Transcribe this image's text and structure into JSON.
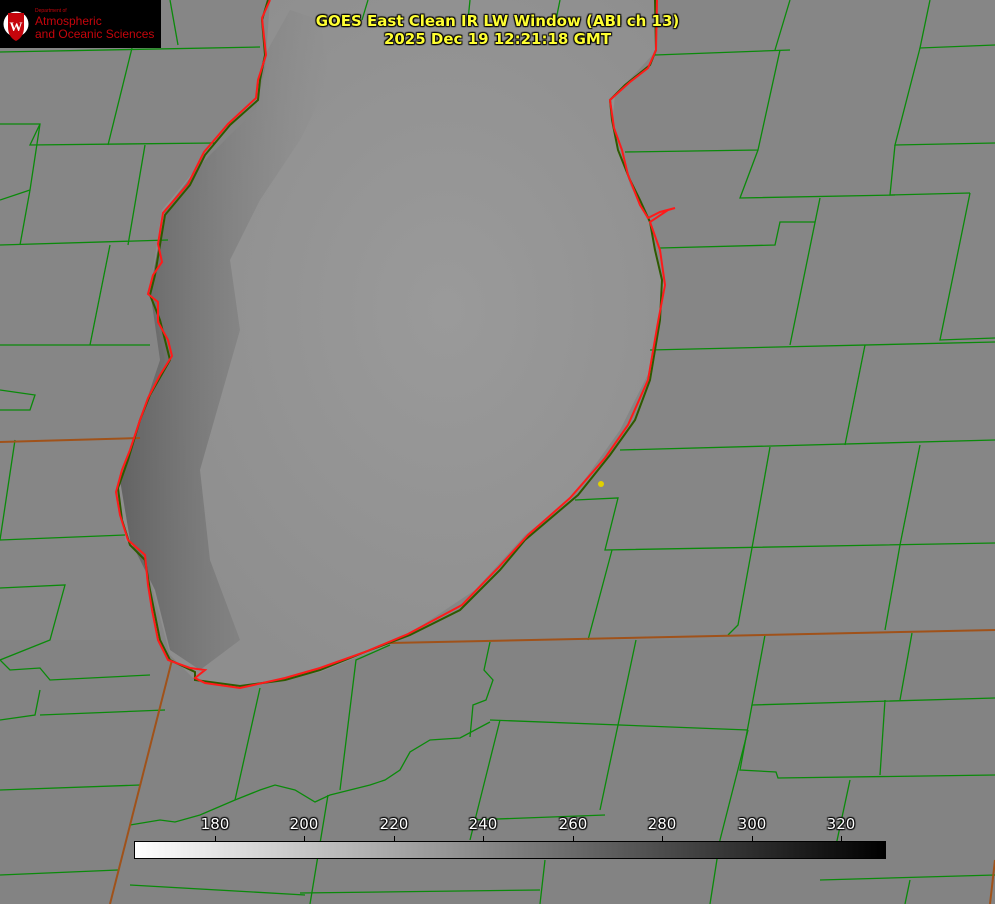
{
  "title": {
    "line1": "GOES East Clean IR LW Window (ABI ch 13)",
    "line2": "2025 Dec 19 12:21:18 GMT"
  },
  "logo": {
    "department": "Department of",
    "line1": "Atmospheric",
    "line2": "and Oceanic Sciences"
  },
  "colorbar": {
    "ticks": [
      "180",
      "200",
      "220",
      "240",
      "260",
      "280",
      "300",
      "320"
    ],
    "colormap": "white-to-black grayscale"
  },
  "colors": {
    "title_text": "#ffff33",
    "county_lines": "#0a8a0a",
    "state_lines": "#a0521a",
    "lake_outline": "#ff1a1a",
    "marker": "#e0d000"
  }
}
